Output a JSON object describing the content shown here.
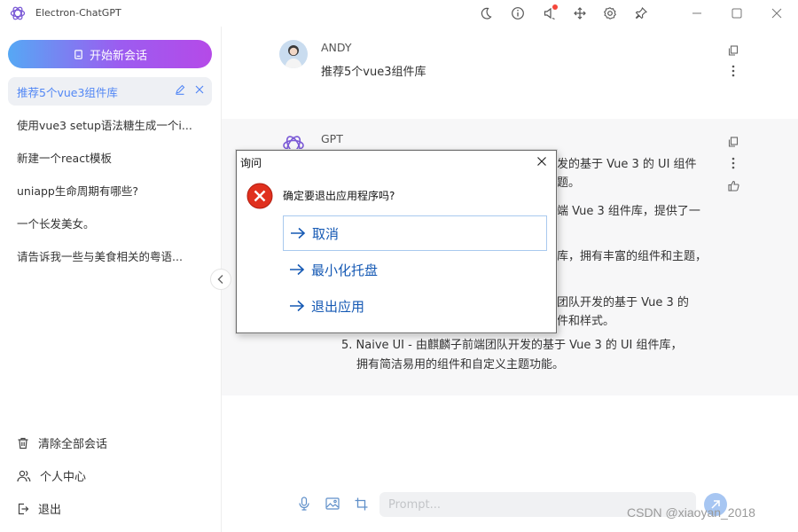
{
  "app": {
    "title": "Electron-ChatGPT"
  },
  "titlebar": {
    "icons": [
      "moon-icon",
      "info-icon",
      "notification-icon",
      "move-icon",
      "settings-icon",
      "pin-icon"
    ],
    "window_controls": [
      "minimize-icon",
      "maximize-icon",
      "close-icon"
    ],
    "notification_color": "#f5473c"
  },
  "sidebar": {
    "new_chat_label": "开始新会话",
    "conversations": [
      {
        "label": "推荐5个vue3组件库",
        "active": true
      },
      {
        "label": "使用vue3 setup语法糖生成一个i..."
      },
      {
        "label": "新建一个react模板"
      },
      {
        "label": "uniapp生命周期有哪些?"
      },
      {
        "label": "一个长发美女。"
      },
      {
        "label": "请告诉我一些与美食相关的粤语..."
      }
    ],
    "bottom": [
      {
        "label": "清除全部会话",
        "icon": "trash-icon"
      },
      {
        "label": "个人中心",
        "icon": "users-icon"
      },
      {
        "label": "退出",
        "icon": "logout-icon"
      }
    ],
    "accent": "#5287f5",
    "gradient": [
      "#56a8f4",
      "#b54ae8"
    ]
  },
  "messages": [
    {
      "role": "user",
      "name": "ANDY",
      "text": "推荐5个vue3组件库"
    },
    {
      "role": "assistant",
      "name": "GPT",
      "fragments": [
        "发的基于 Vue 3 的 UI 组件",
        "题。",
        "端 Vue 3 组件库，提供了一",
        "库，拥有丰富的组件和主题，",
        "团队开发的基于 Vue 3 的",
        "件和样式。"
      ],
      "list_item_5": {
        "line1": "5. Naive UI - 由麒麟子前端团队开发的基于 Vue 3 的 UI 组件库，",
        "line2": "拥有简洁易用的组件和自定义主题功能。"
      }
    }
  ],
  "input": {
    "placeholder": "Prompt...",
    "value": ""
  },
  "watermark": "CSDN @xiaoyan_2018",
  "dialog": {
    "title": "询问",
    "message": "确定要退出应用程序吗?",
    "options": [
      "取消",
      "最小化托盘",
      "退出应用"
    ],
    "error_color": "#e0301e",
    "link_color": "#1559b4"
  }
}
